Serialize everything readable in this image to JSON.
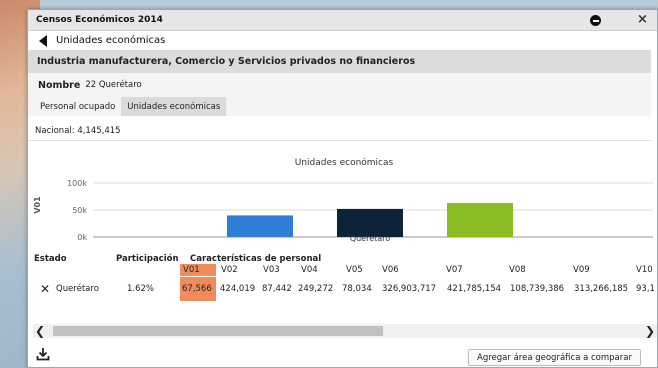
{
  "window": {
    "title": "Censos Económicos 2014",
    "back_label": "Unidades económicas",
    "subtitle": "Industria manufacturera, Comercio y Servicios privados no financieros"
  },
  "nombre": {
    "label": "Nombre",
    "value": "22 Querétaro"
  },
  "tabs": [
    {
      "label": "Personal ocupado",
      "active": false
    },
    {
      "label": "Unidades económicas",
      "active": true
    }
  ],
  "nacional": "Nacional: 4,145,415",
  "chart_data": {
    "type": "bar",
    "title": "Unidades económicas",
    "ylabel": "V01",
    "ylim": [
      0,
      100000
    ],
    "yticks": [
      "100k",
      "50k",
      "0k"
    ],
    "ytick_values": [
      100000,
      50000,
      0
    ],
    "categories": [
      "Querétaro"
    ],
    "series": [
      {
        "values": [
          40000
        ],
        "color": "#2f7ed8"
      },
      {
        "values": [
          52000
        ],
        "color": "#0d233a"
      },
      {
        "values": [
          63000
        ],
        "color": "#8bbc21"
      }
    ],
    "grid": true
  },
  "table": {
    "headers": {
      "estado": "Estado",
      "participacion": "Participación",
      "caracteristicas": "Características de personal"
    },
    "columns": [
      "V01",
      "V02",
      "V03",
      "V04",
      "V05",
      "V06",
      "V07",
      "V08",
      "V09",
      "V10"
    ],
    "row": {
      "estado": "Querétaro",
      "participacion": "1.62%",
      "values": [
        "67,566",
        "424,019",
        "87,442",
        "249,272",
        "78,034",
        "326,903,717",
        "421,785,154",
        "108,739,386",
        "313,266,185",
        "93,1"
      ]
    },
    "highlight_color": "#f28b5c"
  },
  "actions": {
    "compare_button": "Agregar área geográfica a comparar"
  },
  "icons": {
    "back": "back-arrow-icon",
    "minimize": "minimize-icon",
    "close": "close-icon",
    "remove": "remove-icon",
    "download": "download-icon",
    "scroll_left": "chevron-left-icon",
    "scroll_right": "chevron-right-icon"
  }
}
